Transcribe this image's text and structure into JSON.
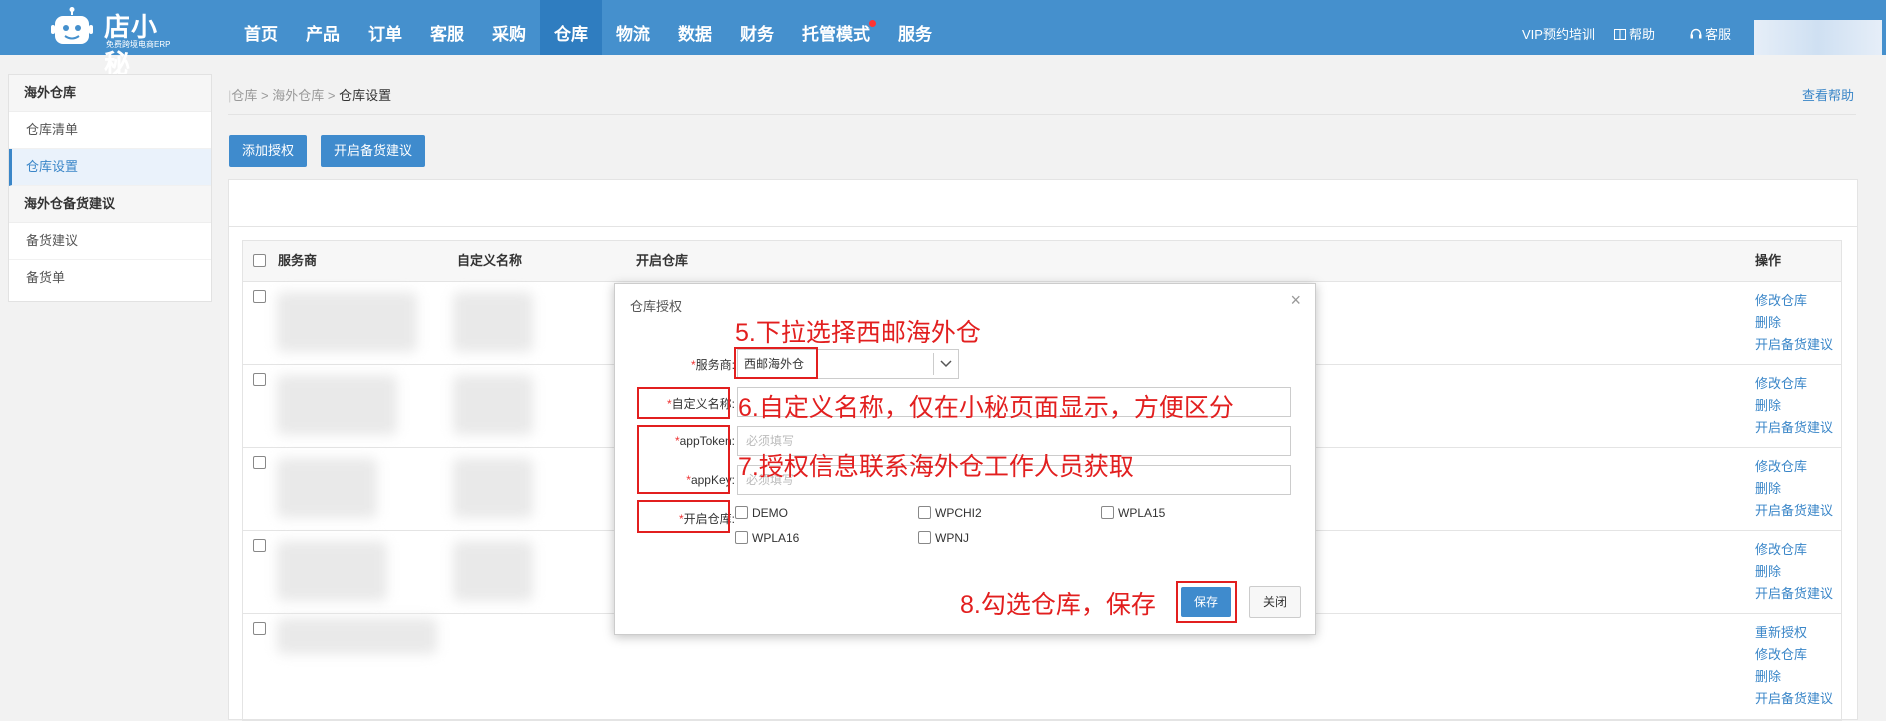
{
  "logo": {
    "name": "店小秘",
    "slogan": "免费跨境电商ERP"
  },
  "nav": {
    "items": [
      {
        "label": "首页"
      },
      {
        "label": "产品"
      },
      {
        "label": "订单"
      },
      {
        "label": "客服"
      },
      {
        "label": "采购"
      },
      {
        "label": "仓库",
        "active": true
      },
      {
        "label": "物流"
      },
      {
        "label": "数据"
      },
      {
        "label": "财务"
      },
      {
        "label": "托管模式",
        "dot": true
      },
      {
        "label": "服务"
      }
    ],
    "vip": "VIP预约培训",
    "help": "帮助",
    "service": "客服"
  },
  "sidebar": {
    "group1": "海外仓库",
    "group1_items": [
      "仓库清单",
      "仓库设置"
    ],
    "group2": "海外仓备货建议",
    "group2_items": [
      "备货建议",
      "备货单"
    ]
  },
  "breadcrumb": {
    "a": "仓库",
    "b": "海外仓库",
    "current": "仓库设置"
  },
  "help_link": "查看帮助",
  "actions": {
    "add_auth": "添加授权",
    "enable_suggest": "开启备货建议"
  },
  "table": {
    "headers": {
      "provider": "服务商",
      "custom_name": "自定义名称",
      "warehouse": "开启仓库",
      "ops": "操作"
    },
    "rows": [
      {
        "ops": [
          "修改仓库",
          "删除",
          "开启备货建议"
        ]
      },
      {
        "ops": [
          "修改仓库",
          "删除",
          "开启备货建议"
        ]
      },
      {
        "ops": [
          "修改仓库",
          "删除",
          "开启备货建议"
        ]
      },
      {
        "ops": [
          "修改仓库",
          "删除",
          "开启备货建议"
        ]
      },
      {
        "ops": [
          "重新授权",
          "修改仓库",
          "删除",
          "开启备货建议"
        ]
      }
    ]
  },
  "modal": {
    "title": "仓库授权",
    "provider_label": "服务商:",
    "provider_value": "西邮海外仓",
    "custom_label": "自定义名称:",
    "token_label": "appToken:",
    "token_placeholder": "必须填写",
    "key_label": "appKey:",
    "key_placeholder": "必须填写",
    "wh_label": "开启仓库:",
    "warehouses": [
      "DEMO",
      "WPCHI2",
      "WPLA15",
      "WPLA16",
      "WPNJ"
    ],
    "save": "保存",
    "close": "关闭"
  },
  "annotations": {
    "a5": "5.下拉选择西邮海外仓",
    "a6": "6.自定义名称，仅在小秘页面显示，方便区分",
    "a7": "7.授权信息联系海外仓工作人员获取",
    "a8": "8.勾选仓库，保存"
  },
  "colors": {
    "nav": "#4590cd",
    "primary": "#3f8bcd",
    "annotation": "#e21f1f",
    "link": "#3a86c8"
  }
}
